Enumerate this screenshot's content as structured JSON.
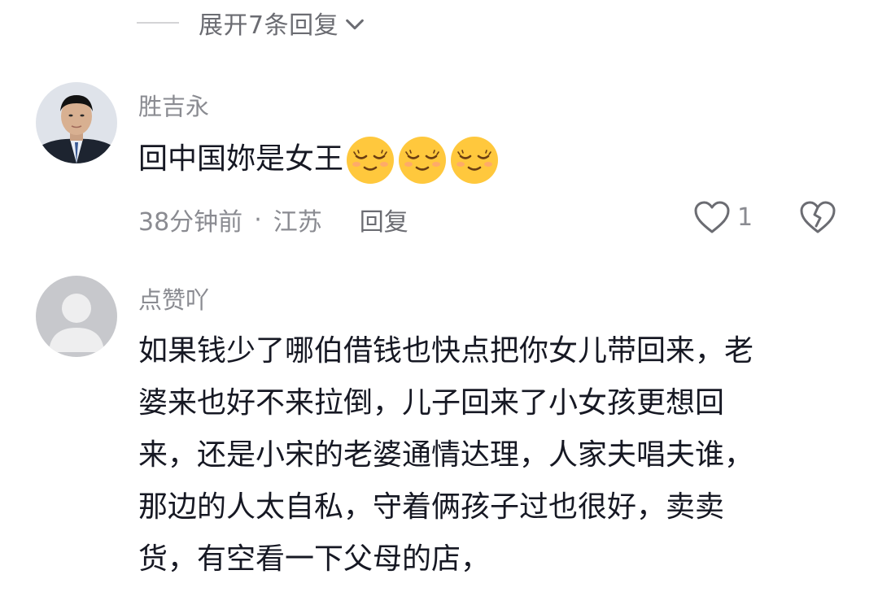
{
  "replies_toggle": {
    "label": "展开7条回复",
    "icon": "chevron-down-icon"
  },
  "comments": [
    {
      "username": "胜吉永",
      "text": "回中国妳是女王",
      "emojis": [
        "smiling-closed-eyes-emoji",
        "smiling-closed-eyes-emoji",
        "smiling-closed-eyes-emoji"
      ],
      "time": "38分钟前",
      "separator": "·",
      "location": "江苏",
      "reply_label": "回复",
      "like_count": "1"
    },
    {
      "username": "点赞吖",
      "lines": [
        "如果钱少了哪伯借钱也快点把你女儿带回来，老",
        "婆来也好不来拉倒，儿子回来了小女孩更想回",
        "来，还是小宋的老婆通情达理，人家夫唱夫谁，",
        "那边的人太自私，守着俩孩子过也很好，卖卖",
        "货，有空看一下父母的店，"
      ]
    }
  ],
  "colors": {
    "primary_text": "#161823",
    "secondary_text": "#8a8b91",
    "toggle_text": "#6b6c72",
    "emoji_yellow": "#ffc83d"
  }
}
